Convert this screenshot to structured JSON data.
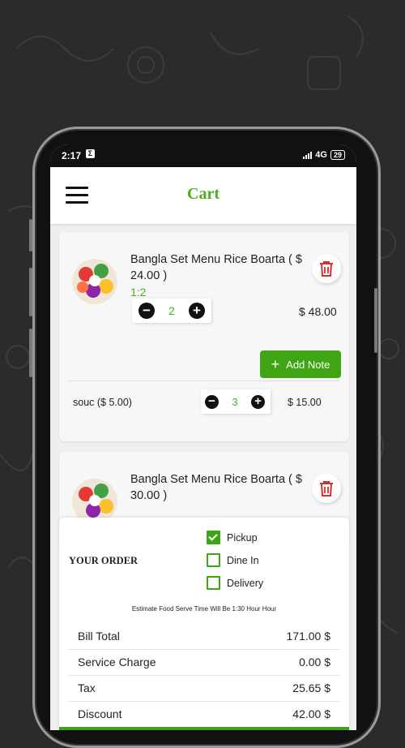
{
  "status": {
    "time": "2:17",
    "network": "4G",
    "battery": "29"
  },
  "app": {
    "title": "Cart"
  },
  "items": [
    {
      "name": "Bangla Set Menu Rice Boarta ( $ 24.00 )",
      "qty_label": "1:2",
      "quantity": "2",
      "price": "$ 48.00",
      "add_note_label": "Add Note",
      "addon": {
        "name": "souc ($ 5.00)",
        "quantity": "3",
        "price": "$ 15.00"
      }
    },
    {
      "name": "Bangla Set Menu Rice Boarta ( $ 30.00 )"
    }
  ],
  "order": {
    "title": "YOUR ORDER",
    "options": [
      {
        "label": "Pickup",
        "checked": true
      },
      {
        "label": "Dine In",
        "checked": false
      },
      {
        "label": "Delivery",
        "checked": false
      }
    ],
    "estimate": "Estimate Food Serve Time Will Be 1:30 Hour Hour",
    "bill": [
      {
        "label": "Bill Total",
        "value": "171.00 $"
      },
      {
        "label": "Service Charge",
        "value": "0.00 $"
      },
      {
        "label": "Tax",
        "value": "25.65 $"
      },
      {
        "label": "Discount",
        "value": "42.00 $"
      }
    ]
  },
  "colors": {
    "accent": "#4caf1a",
    "button": "#3fa514",
    "delete": "#d32f2f"
  }
}
